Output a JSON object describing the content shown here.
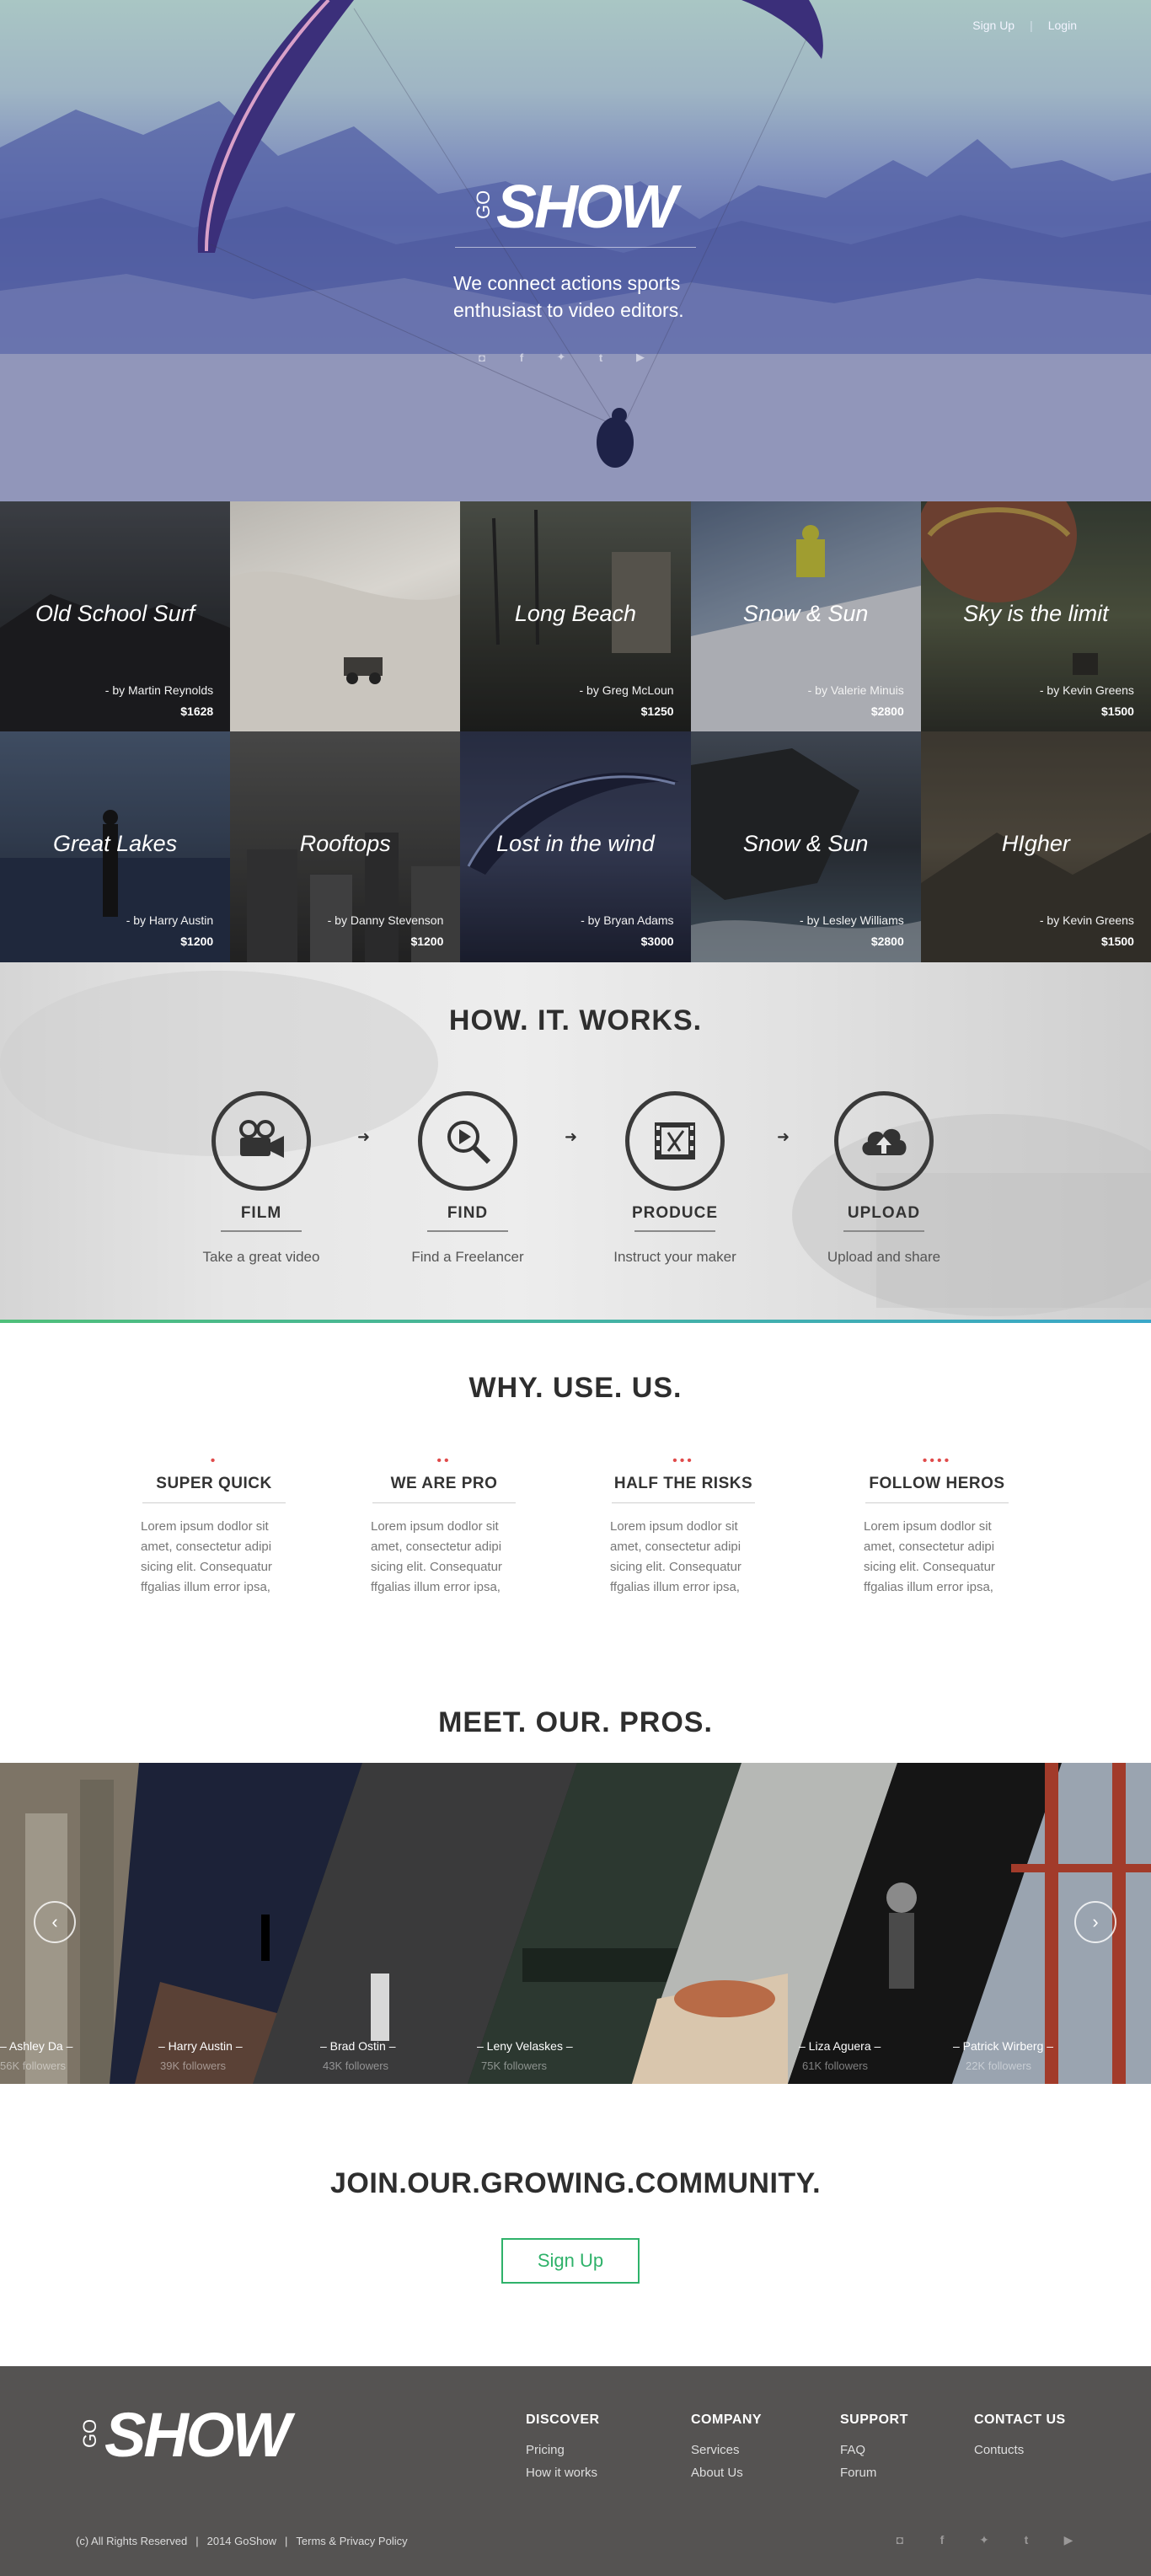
{
  "header": {
    "signup_label": "Sign Up",
    "login_label": "Login",
    "separator": "|",
    "logo_prefix": "GO",
    "logo_text": "SHOW",
    "tagline": "We connect actions sports enthusiast to video editors.",
    "social_icons": [
      "instagram-icon",
      "facebook-icon",
      "twitter-icon",
      "tumblr-icon",
      "youtube-icon"
    ]
  },
  "gallery": {
    "tiles": [
      {
        "title": "Old School Surf",
        "by": "- by Martin Reynolds",
        "price": "$1628"
      },
      {
        "title": "",
        "by": "",
        "price": ""
      },
      {
        "title": "Long Beach",
        "by": "- by Greg McLoun",
        "price": "$1250"
      },
      {
        "title": "Snow & Sun",
        "by": "- by Valerie Minuis",
        "price": "$2800"
      },
      {
        "title": "Sky is the limit",
        "by": "- by Kevin Greens",
        "price": "$1500"
      },
      {
        "title": "Great Lakes",
        "by": "- by Harry Austin",
        "price": "$1200"
      },
      {
        "title": "Rooftops",
        "by": "- by Danny Stevenson",
        "price": "$1200"
      },
      {
        "title": "Lost in the wind",
        "by": "- by Bryan Adams",
        "price": "$3000"
      },
      {
        "title": "Snow & Sun",
        "by": "- by Lesley Williams",
        "price": "$2800"
      },
      {
        "title": "HIgher",
        "by": "- by Kevin Greens",
        "price": "$1500"
      }
    ]
  },
  "how": {
    "title": "HOW. IT. WORKS.",
    "steps": [
      {
        "label": "FILM",
        "desc": "Take a great video",
        "icon": "film-camera-icon"
      },
      {
        "label": "FIND",
        "desc": "Find a Freelancer",
        "icon": "search-play-icon"
      },
      {
        "label": "PRODUCE",
        "desc": "Instruct your maker",
        "icon": "film-strip-edit-icon"
      },
      {
        "label": "UPLOAD",
        "desc": "Upload and share",
        "icon": "cloud-upload-icon"
      }
    ]
  },
  "why": {
    "title": "WHY. USE. US.",
    "items": [
      {
        "dots": "•",
        "title": "SUPER QUICK",
        "body": "Lorem ipsum dodlor sit amet, consectetur adipi sicing elit. Consequatur ffgalias illum error ipsa,"
      },
      {
        "dots": "••",
        "title": "WE ARE PRO",
        "body": "Lorem ipsum dodlor sit amet, consectetur adipi sicing elit. Consequatur ffgalias illum error ipsa,"
      },
      {
        "dots": "•••",
        "title": "HALF THE RISKS",
        "body": "Lorem ipsum dodlor sit amet, consectetur adipi sicing elit. Consequatur ffgalias illum error ipsa,"
      },
      {
        "dots": "••••",
        "title": "FOLLOW HEROS",
        "body": "Lorem ipsum dodlor sit amet, consectetur adipi sicing elit. Consequatur ffgalias illum error ipsa,"
      }
    ]
  },
  "pros": {
    "title": "MEET. OUR. PROS.",
    "people": [
      {
        "name": "– Ashley Da –",
        "followers": "56K followers"
      },
      {
        "name": "– Harry Austin –",
        "followers": "39K followers"
      },
      {
        "name": "– Brad Ostin –",
        "followers": "43K followers"
      },
      {
        "name": "– Leny Velaskes –",
        "followers": "75K followers"
      },
      {
        "name": "– Liza Aguera –",
        "followers": "61K followers"
      },
      {
        "name": "– Patrick Wirberg –",
        "followers": "22K followers"
      }
    ],
    "prev_icon": "chevron-left-icon",
    "next_icon": "chevron-right-icon"
  },
  "community": {
    "title": "JOIN.OUR.GROWING.COMMUNITY.",
    "button": "Sign Up"
  },
  "footer": {
    "logo_prefix": "GO",
    "logo_text": "SHOW",
    "columns": [
      {
        "heading": "DISCOVER",
        "links": [
          "Pricing",
          "How it works"
        ]
      },
      {
        "heading": "COMPANY",
        "links": [
          "Services",
          "About Us"
        ]
      },
      {
        "heading": "SUPPORT",
        "links": [
          "FAQ",
          "Forum"
        ]
      },
      {
        "heading": "CONTACT US",
        "links": [
          "Contucts"
        ]
      }
    ],
    "copyright": "(c) All Rights Reserved",
    "year_brand": "2014  GoShow",
    "policy": "Terms & Privacy Policy",
    "sep": "|",
    "social_icons": [
      "instagram-icon",
      "facebook-icon",
      "twitter-icon",
      "tumblr-icon",
      "youtube-icon"
    ]
  },
  "colors": {
    "accent_green": "#2fb26a",
    "dot_red": "#e04b4b",
    "footer_bg": "#555352"
  }
}
